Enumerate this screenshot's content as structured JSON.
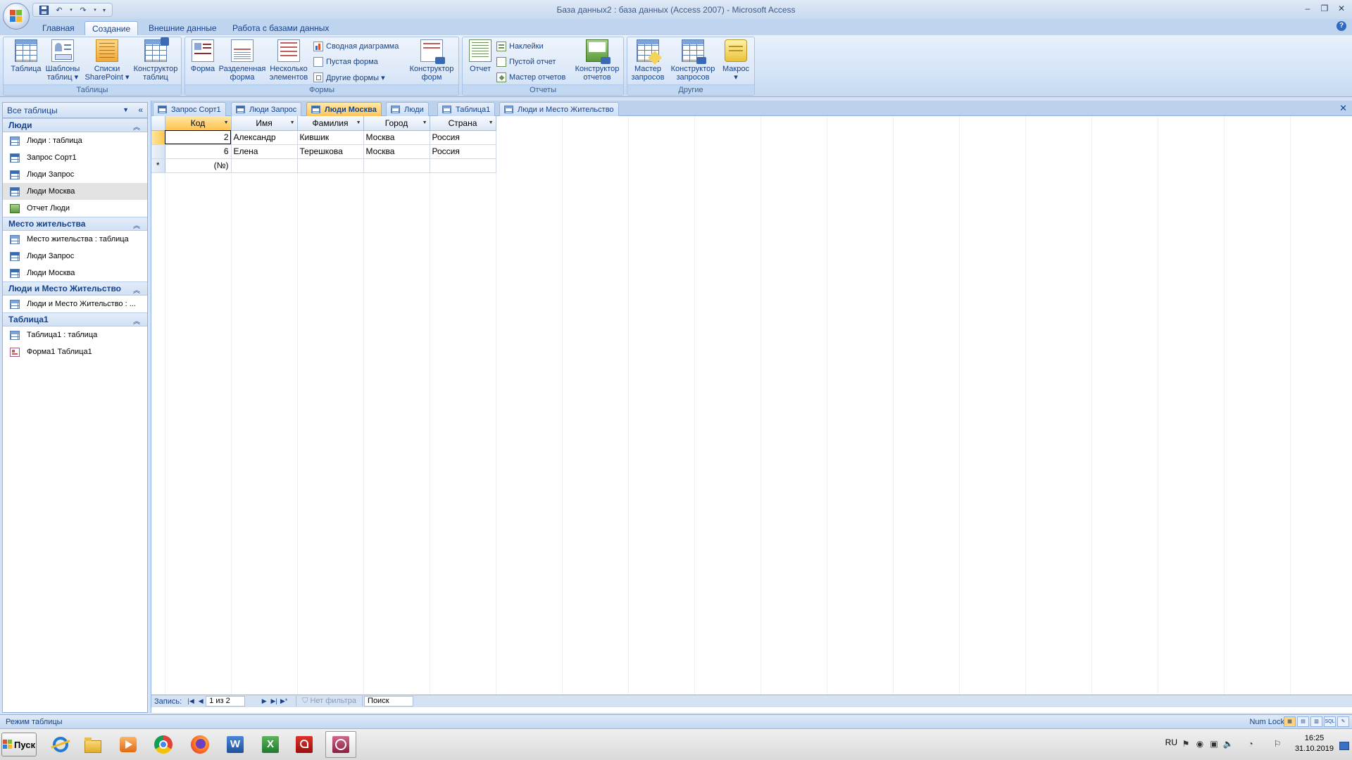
{
  "window": {
    "title": "База данных2 : база данных (Access 2007) - Microsoft Access"
  },
  "ribbon_tabs": [
    {
      "label": "Главная",
      "active": false
    },
    {
      "label": "Создание",
      "active": true
    },
    {
      "label": "Внешние данные",
      "active": false
    },
    {
      "label": "Работа с базами данных",
      "active": false
    }
  ],
  "ribbon": {
    "groups": {
      "tables": {
        "label": "Таблицы",
        "buttons": [
          {
            "line1": "Таблица",
            "line2": ""
          },
          {
            "line1": "Шаблоны",
            "line2": "таблиц ▾"
          },
          {
            "line1": "Списки",
            "line2": "SharePoint ▾"
          },
          {
            "line1": "Конструктор",
            "line2": "таблиц"
          }
        ]
      },
      "forms": {
        "label": "Формы",
        "buttons": [
          {
            "line1": "Форма",
            "line2": ""
          },
          {
            "line1": "Разделенная",
            "line2": "форма"
          },
          {
            "line1": "Несколько",
            "line2": "элементов"
          },
          {
            "line1": "Конструктор",
            "line2": "форм"
          }
        ],
        "small": [
          "Сводная диаграмма",
          "Пустая форма",
          "Другие формы ▾"
        ]
      },
      "reports": {
        "label": "Отчеты",
        "buttons": [
          {
            "line1": "Отчет",
            "line2": ""
          },
          {
            "line1": "Конструктор",
            "line2": "отчетов"
          }
        ],
        "small": [
          "Наклейки",
          "Пустой отчет",
          "Мастер отчетов"
        ]
      },
      "other": {
        "label": "Другие",
        "buttons": [
          {
            "line1": "Мастер",
            "line2": "запросов"
          },
          {
            "line1": "Конструктор",
            "line2": "запросов"
          },
          {
            "line1": "Макрос",
            "line2": "▾"
          }
        ]
      }
    }
  },
  "nav": {
    "header": "Все таблицы",
    "groups": [
      {
        "title": "Люди",
        "items": [
          {
            "label": "Люди : таблица",
            "type": "table",
            "selected": false
          },
          {
            "label": "Запрос Сорт1",
            "type": "query",
            "selected": false
          },
          {
            "label": "Люди Запрос",
            "type": "query",
            "selected": false
          },
          {
            "label": "Люди Москва",
            "type": "query",
            "selected": true
          },
          {
            "label": "Отчет Люди",
            "type": "report",
            "selected": false
          }
        ]
      },
      {
        "title": "Место жительства",
        "items": [
          {
            "label": "Место жительства : таблица",
            "type": "table",
            "selected": false
          },
          {
            "label": "Люди Запрос",
            "type": "query",
            "selected": false
          },
          {
            "label": "Люди Москва",
            "type": "query",
            "selected": false
          }
        ]
      },
      {
        "title": "Люди и Место Жительство",
        "items": [
          {
            "label": "Люди и Место Жительство : ...",
            "type": "table",
            "selected": false
          }
        ]
      },
      {
        "title": "Таблица1",
        "items": [
          {
            "label": "Таблица1 : таблица",
            "type": "table",
            "selected": false
          },
          {
            "label": "Форма1 Таблица1",
            "type": "form",
            "selected": false
          }
        ]
      }
    ]
  },
  "doc_tabs": [
    {
      "label": "Запрос Сорт1",
      "type": "query",
      "active": false
    },
    {
      "label": "Люди Запрос",
      "type": "query",
      "active": false
    },
    {
      "label": "Люди Москва",
      "type": "query",
      "active": true
    },
    {
      "label": "Люди",
      "type": "table",
      "active": false
    },
    {
      "label": "Таблица1",
      "type": "table",
      "active": false
    },
    {
      "label": "Люди и Место Жительство",
      "type": "table",
      "active": false
    }
  ],
  "datasheet": {
    "columns": [
      "Код",
      "Имя",
      "Фамилия",
      "Город",
      "Страна"
    ],
    "rows": [
      [
        "2",
        "Александр",
        "Кившик",
        "Москва",
        "Россия"
      ],
      [
        "6",
        "Елена",
        "Терешкова",
        "Москва",
        "Россия"
      ]
    ],
    "new_row_marker": "*",
    "new_row_placeholder": "(№)"
  },
  "record_nav": {
    "label": "Запись:",
    "current": "1 из 2",
    "filter": "Нет фильтра",
    "search": "Поиск"
  },
  "status": {
    "left": "Режим таблицы",
    "right": "Num Lock"
  },
  "taskbar": {
    "start": "Пуск",
    "lang": "RU",
    "time": "16:25",
    "date": "31.10.2019"
  }
}
